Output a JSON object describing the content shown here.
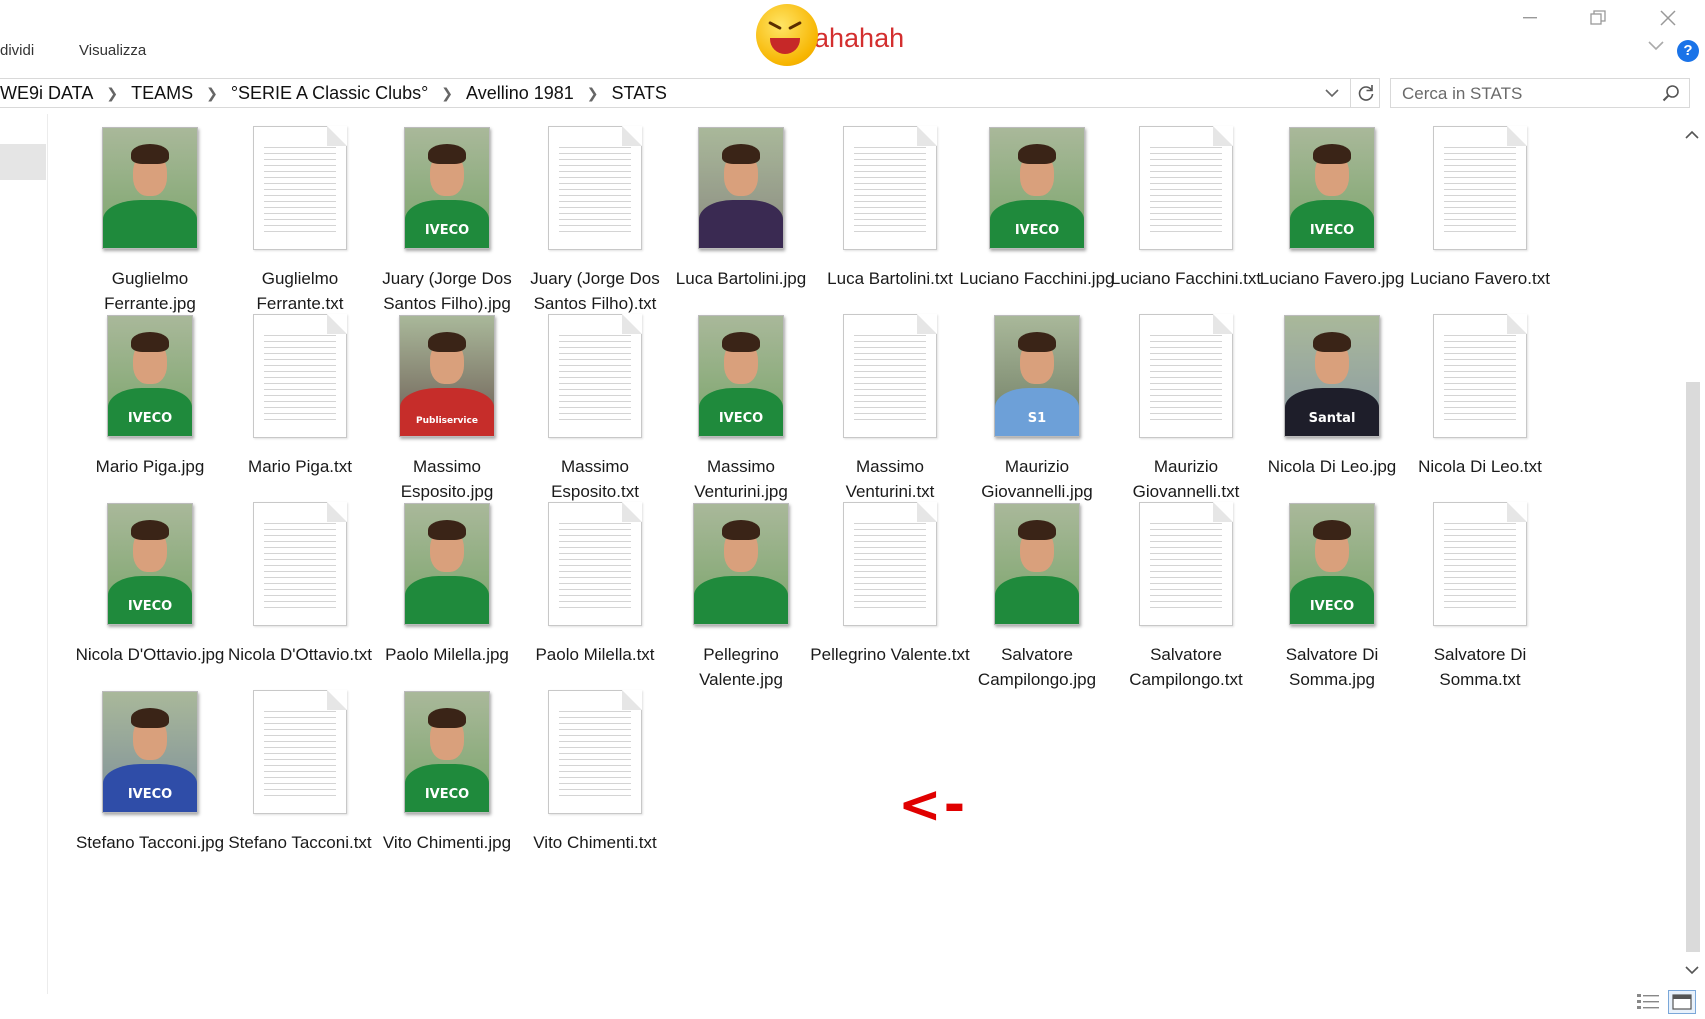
{
  "ribbon": {
    "tab_share": "dividi",
    "tab_view": "Visualizza"
  },
  "logo": {
    "text": "ahahah",
    "emoji": "laughing-face-icon"
  },
  "breadcrumb": [
    "WE9i DATA",
    "TEAMS",
    "°SERIE A Classic Clubs°",
    "Avellino 1981",
    "STATS"
  ],
  "search": {
    "placeholder": "Cerca in STATS"
  },
  "annotation": {
    "text": "<-",
    "color": "#e00000"
  },
  "files": [
    {
      "name": "Guglielmo Ferrante.jpg",
      "type": "jpg",
      "kit": "green",
      "sponsor": ""
    },
    {
      "name": "Guglielmo Ferrante.txt",
      "type": "txt"
    },
    {
      "name": "Juary (Jorge Dos Santos Filho).jpg",
      "type": "jpg",
      "kit": "green",
      "sponsor": "IVECO"
    },
    {
      "name": "Juary (Jorge Dos Santos Filho).txt",
      "type": "txt"
    },
    {
      "name": "Luca Bartolini.jpg",
      "type": "jpg",
      "kit": "purple",
      "sponsor": ""
    },
    {
      "name": "Luca Bartolini.txt",
      "type": "txt"
    },
    {
      "name": "Luciano Facchini.jpg",
      "type": "jpg",
      "kit": "green",
      "sponsor": "IVECO"
    },
    {
      "name": "Luciano Facchini.txt",
      "type": "txt"
    },
    {
      "name": "Luciano Favero.jpg",
      "type": "jpg",
      "kit": "green",
      "sponsor": "IVECO"
    },
    {
      "name": "Luciano Favero.txt",
      "type": "txt"
    },
    {
      "name": "Mario Piga.jpg",
      "type": "jpg",
      "kit": "green",
      "sponsor": "IVECO"
    },
    {
      "name": "Mario Piga.txt",
      "type": "txt"
    },
    {
      "name": "Massimo Esposito.jpg",
      "type": "jpg",
      "kit": "red",
      "sponsor": "Publiservice"
    },
    {
      "name": "Massimo Esposito.txt",
      "type": "txt"
    },
    {
      "name": "Massimo Venturini.jpg",
      "type": "jpg",
      "kit": "green",
      "sponsor": "IVECO"
    },
    {
      "name": "Massimo Venturini.txt",
      "type": "txt"
    },
    {
      "name": "Maurizio Giovannelli.jpg",
      "type": "jpg",
      "kit": "skyblue",
      "sponsor": "S1"
    },
    {
      "name": "Maurizio Giovannelli.txt",
      "type": "txt"
    },
    {
      "name": "Nicola Di Leo.jpg",
      "type": "jpg",
      "kit": "black",
      "sponsor": "Santal"
    },
    {
      "name": "Nicola Di Leo.txt",
      "type": "txt"
    },
    {
      "name": "Nicola D'Ottavio.jpg",
      "type": "jpg",
      "kit": "green",
      "sponsor": "IVECO"
    },
    {
      "name": "Nicola D'Ottavio.txt",
      "type": "txt"
    },
    {
      "name": "Paolo Milella.jpg",
      "type": "jpg",
      "kit": "green",
      "sponsor": ""
    },
    {
      "name": "Paolo Milella.txt",
      "type": "txt"
    },
    {
      "name": "Pellegrino Valente.jpg",
      "type": "jpg",
      "kit": "green",
      "sponsor": ""
    },
    {
      "name": "Pellegrino Valente.txt",
      "type": "txt"
    },
    {
      "name": "Salvatore Campilongo.jpg",
      "type": "jpg",
      "kit": "green",
      "sponsor": ""
    },
    {
      "name": "Salvatore Campilongo.txt",
      "type": "txt"
    },
    {
      "name": "Salvatore Di Somma.jpg",
      "type": "jpg",
      "kit": "green",
      "sponsor": "IVECO"
    },
    {
      "name": "Salvatore Di Somma.txt",
      "type": "txt"
    },
    {
      "name": "Stefano Tacconi.jpg",
      "type": "jpg",
      "kit": "blue",
      "sponsor": "IVECO"
    },
    {
      "name": "Stefano Tacconi.txt",
      "type": "txt"
    },
    {
      "name": "Vito Chimenti.jpg",
      "type": "jpg",
      "kit": "green",
      "sponsor": "IVECO"
    },
    {
      "name": "Vito Chimenti.txt",
      "type": "txt"
    }
  ]
}
